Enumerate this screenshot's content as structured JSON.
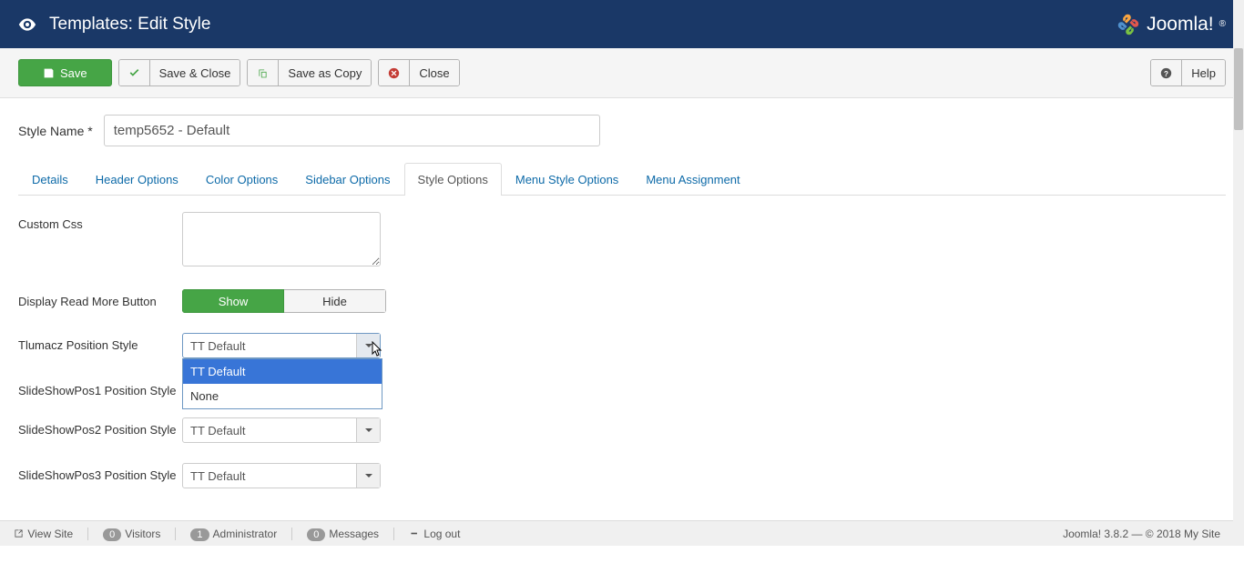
{
  "header": {
    "title": "Templates: Edit Style",
    "brand": "Joomla!"
  },
  "toolbar": {
    "save": "Save",
    "save_close": "Save & Close",
    "save_copy": "Save as Copy",
    "close": "Close",
    "help": "Help"
  },
  "style_name": {
    "label": "Style Name *",
    "value": "temp5652 - Default"
  },
  "tabs": [
    {
      "label": "Details"
    },
    {
      "label": "Header Options"
    },
    {
      "label": "Color Options"
    },
    {
      "label": "Sidebar Options"
    },
    {
      "label": "Style Options",
      "active": true
    },
    {
      "label": "Menu Style Options"
    },
    {
      "label": "Menu Assignment"
    }
  ],
  "form": {
    "custom_css_label": "Custom Css",
    "custom_css_value": "",
    "read_more_label": "Display Read More Button",
    "read_more_show": "Show",
    "read_more_hide": "Hide",
    "tlumacz_label": "Tlumacz Position Style",
    "tlumacz_value": "TT Default",
    "tlumacz_options": [
      "TT Default",
      "None"
    ],
    "ss1_label": "SlideShowPos1 Position Style",
    "ss2_label": "SlideShowPos2 Position Style",
    "ss2_value": "TT Default",
    "ss3_label": "SlideShowPos3 Position Style",
    "ss3_value": "TT Default"
  },
  "status": {
    "view_site": "View Site",
    "visitors_count": "0",
    "visitors": "Visitors",
    "admin_count": "1",
    "admin": "Administrator",
    "messages_count": "0",
    "messages": "Messages",
    "logout": "Log out",
    "version": "Joomla! 3.8.2 — © 2018 My Site"
  }
}
